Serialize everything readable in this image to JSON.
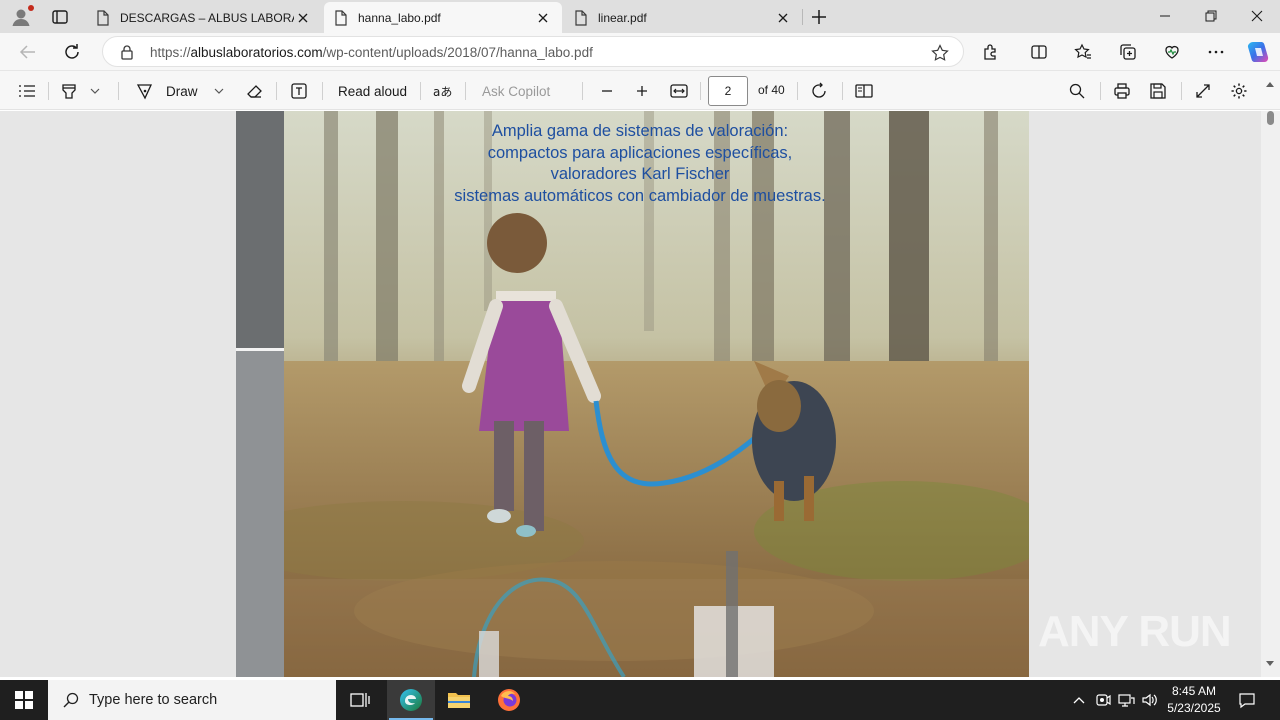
{
  "tabs": [
    {
      "title": "DESCARGAS – ALBUS LABORATORIOS",
      "active": false
    },
    {
      "title": "hanna_labo.pdf",
      "active": true
    },
    {
      "title": "linear.pdf",
      "active": false
    }
  ],
  "address": {
    "prefix": "https://",
    "domain": "albuslaboratorios.com",
    "path": "/wp-content/uploads/2018/07/hanna_labo.pdf"
  },
  "pdf_toolbar": {
    "draw_label": "Draw",
    "read_aloud_label": "Read aloud",
    "ask_copilot_label": "Ask Copilot",
    "page_number": "2",
    "page_count": "of 40"
  },
  "document": {
    "caption_lines": [
      "Amplia gama de sistemas de valoración:",
      "compactos para aplicaciones específicas,",
      "valoradores Karl Fischer",
      "sistemas automáticos con cambiador de muestras."
    ]
  },
  "watermark": "ANY RUN",
  "taskbar": {
    "search_placeholder": "Type here to search",
    "time": "8:45 AM",
    "date": "5/23/2025"
  },
  "colors": {
    "accent": "#0078d4",
    "caption": "#1e4fa0",
    "taskbar": "#1f1f1f"
  }
}
